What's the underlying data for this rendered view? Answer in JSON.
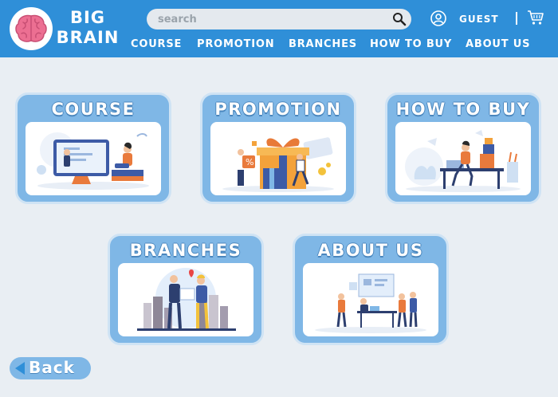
{
  "brand": {
    "line1": "BIG",
    "line2": "BRAIN"
  },
  "search": {
    "placeholder": "search"
  },
  "user": {
    "label": "GUEST"
  },
  "nav": {
    "items": [
      {
        "label": "COURSE"
      },
      {
        "label": "PROMOTION"
      },
      {
        "label": "BRANCHES"
      },
      {
        "label": "HOW TO BUY"
      },
      {
        "label": "ABOUT US"
      }
    ]
  },
  "cards": {
    "course": {
      "title": "COURSE",
      "illustration": "online-course-illustration"
    },
    "promotion": {
      "title": "PROMOTION",
      "illustration": "gift-promotion-illustration"
    },
    "how_to_buy": {
      "title": "HOW TO BUY",
      "illustration": "desk-shopping-illustration"
    },
    "branches": {
      "title": "BRANCHES",
      "illustration": "city-map-illustration"
    },
    "about_us": {
      "title": "ABOUT US",
      "illustration": "team-meeting-illustration"
    }
  },
  "back": {
    "label": "Back"
  },
  "colors": {
    "header": "#2f8fd8",
    "card": "#7fb7e6",
    "background": "#e9eef3",
    "logo_brain": "#ec6f92"
  }
}
